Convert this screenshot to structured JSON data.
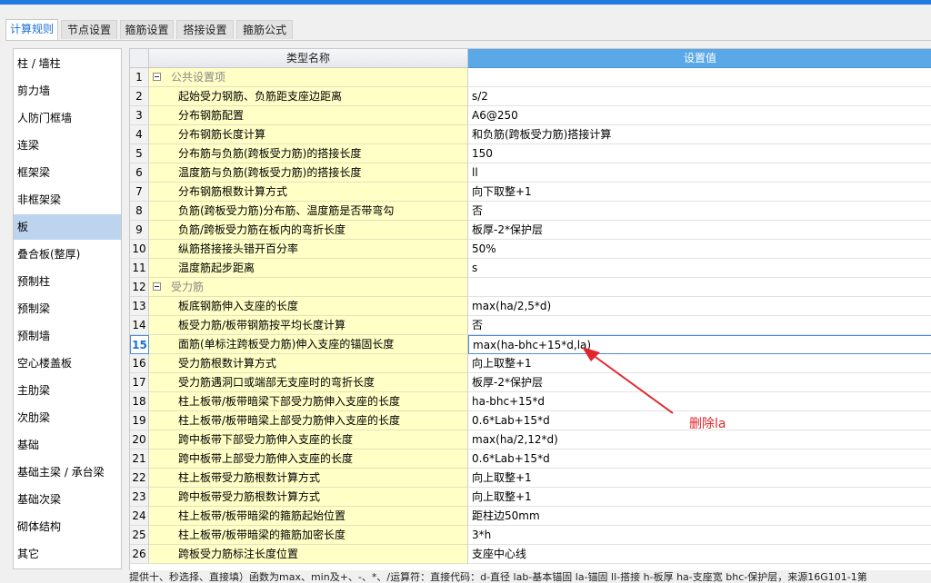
{
  "tabs": [
    {
      "label": "计算规则",
      "active": true
    },
    {
      "label": "节点设置",
      "active": false
    },
    {
      "label": "箍筋设置",
      "active": false
    },
    {
      "label": "搭接设置",
      "active": false
    },
    {
      "label": "箍筋公式",
      "active": false
    }
  ],
  "sidebar": {
    "selected_label": "板",
    "items": [
      "柱 / 墙柱",
      "剪力墙",
      "人防门框墙",
      "连梁",
      "框架梁",
      "非框架梁",
      "板",
      "叠合板(整厚)",
      "预制柱",
      "预制梁",
      "预制墙",
      "空心楼盖板",
      "主肋梁",
      "次肋梁",
      "基础",
      "基础主梁 / 承台梁",
      "基础次梁",
      "砌体结构",
      "其它"
    ]
  },
  "grid": {
    "headers": {
      "name": "类型名称",
      "value": "设置值"
    },
    "current_row": "15",
    "rows": [
      {
        "n": "1",
        "name": "公共设置项",
        "value": "",
        "group": true
      },
      {
        "n": "2",
        "name": "起始受力钢筋、负筋距支座边距离",
        "value": "s/2"
      },
      {
        "n": "3",
        "name": "分布钢筋配置",
        "value": "A6@250"
      },
      {
        "n": "4",
        "name": "分布钢筋长度计算",
        "value": "和负筋(跨板受力筋)搭接计算"
      },
      {
        "n": "5",
        "name": "分布筋与负筋(跨板受力筋)的搭接长度",
        "value": "150"
      },
      {
        "n": "6",
        "name": "温度筋与负筋(跨板受力筋)的搭接长度",
        "value": "ll"
      },
      {
        "n": "7",
        "name": "分布钢筋根数计算方式",
        "value": "向下取整+1"
      },
      {
        "n": "8",
        "name": "负筋(跨板受力筋)分布筋、温度筋是否带弯勾",
        "value": "否"
      },
      {
        "n": "9",
        "name": "负筋/跨板受力筋在板内的弯折长度",
        "value": "板厚-2*保护层"
      },
      {
        "n": "10",
        "name": "纵筋搭接接头错开百分率",
        "value": "50%"
      },
      {
        "n": "11",
        "name": "温度筋起步距离",
        "value": "s"
      },
      {
        "n": "12",
        "name": "受力筋",
        "value": "",
        "group": true
      },
      {
        "n": "13",
        "name": "板底钢筋伸入支座的长度",
        "value": "max(ha/2,5*d)"
      },
      {
        "n": "14",
        "name": "板受力筋/板带钢筋按平均长度计算",
        "value": "否"
      },
      {
        "n": "15",
        "name": "面筋(单标注跨板受力筋)伸入支座的锚固长度",
        "value": "max(ha-bhc+15*d,la)"
      },
      {
        "n": "16",
        "name": "受力筋根数计算方式",
        "value": "向上取整+1"
      },
      {
        "n": "17",
        "name": "受力筋遇洞口或端部无支座时的弯折长度",
        "value": "板厚-2*保护层"
      },
      {
        "n": "18",
        "name": "柱上板带/板带暗梁下部受力筋伸入支座的长度",
        "value": "ha-bhc+15*d"
      },
      {
        "n": "19",
        "name": "柱上板带/板带暗梁上部受力筋伸入支座的长度",
        "value": "0.6*Lab+15*d"
      },
      {
        "n": "20",
        "name": "跨中板带下部受力筋伸入支座的长度",
        "value": "max(ha/2,12*d)"
      },
      {
        "n": "21",
        "name": "跨中板带上部受力筋伸入支座的长度",
        "value": "0.6*Lab+15*d"
      },
      {
        "n": "22",
        "name": "柱上板带受力筋根数计算方式",
        "value": "向上取整+1"
      },
      {
        "n": "23",
        "name": "跨中板带受力筋根数计算方式",
        "value": "向上取整+1"
      },
      {
        "n": "24",
        "name": "柱上板带/板带暗梁的箍筋起始位置",
        "value": "距柱边50mm"
      },
      {
        "n": "25",
        "name": "柱上板带/板带暗梁的箍筋加密长度",
        "value": "3*h"
      },
      {
        "n": "26",
        "name": "跨板受力筋标注长度位置",
        "value": "支座中心线"
      }
    ]
  },
  "annotation": {
    "text": "删除la",
    "color": "#e0262b"
  },
  "status_text": "提供十、秒选择、直接填）函数为max、min及+、-、*、/运算符：直接代码：d-直径 lab-基本锚固 la-锚固 ll-搭接 h-板厚 ha-支座宽 bhc-保护层，来源16G101-1第"
}
